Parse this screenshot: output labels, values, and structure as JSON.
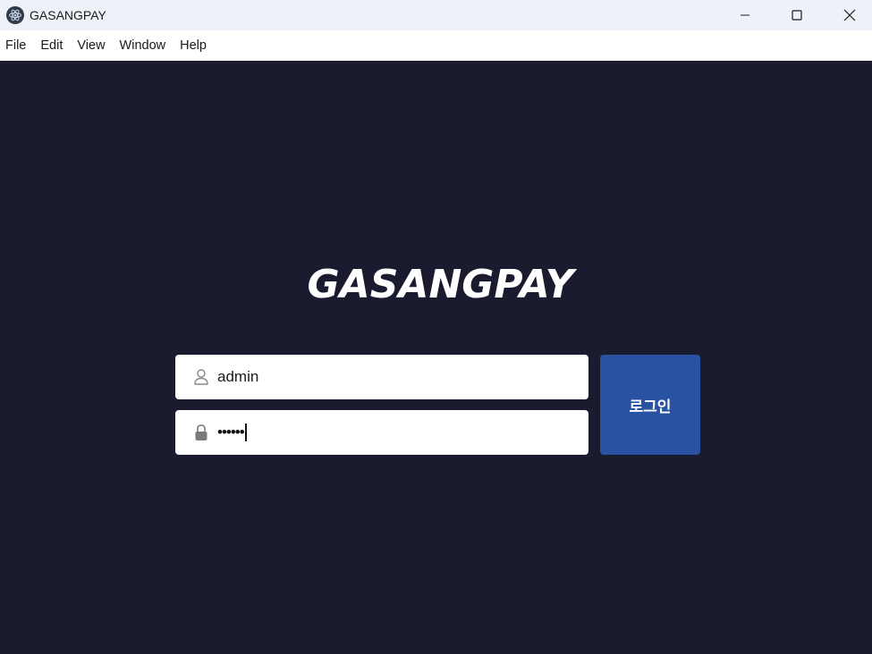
{
  "window": {
    "title": "GASANGPAY",
    "app_icon": "electron-atom-icon",
    "controls": [
      "minimize-icon",
      "maximize-icon",
      "close-icon"
    ]
  },
  "menu": {
    "items": [
      "File",
      "Edit",
      "View",
      "Window",
      "Help"
    ]
  },
  "login": {
    "brand": "GASANGPAY",
    "username": {
      "icon": "user-icon",
      "value": "admin"
    },
    "password": {
      "icon": "lock-icon",
      "masked_value": "••••••"
    },
    "submit_label": "로그인"
  },
  "colors": {
    "background": "#1b1b2f",
    "titlebar": "#eef2f8",
    "menubar": "#ffffff",
    "button": "#2a52a3",
    "brand_text": "#ffffff"
  }
}
